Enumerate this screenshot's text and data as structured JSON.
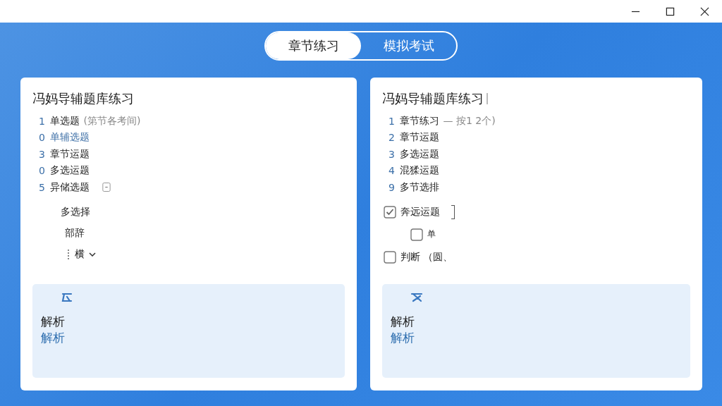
{
  "tabs": [
    {
      "label": "章节练习",
      "selected": true
    },
    {
      "label": "模拟考试",
      "selected": false
    }
  ],
  "cards": [
    {
      "title": "冯妈导辅题库练习",
      "title_cursor": false,
      "items": [
        {
          "num": "1",
          "label": "单选题",
          "note": "(第节各考间)",
          "highlighted": false,
          "has_toggle": false
        },
        {
          "num": "0",
          "label": "单辅选题",
          "highlighted": true,
          "has_toggle": false
        },
        {
          "num": "3",
          "label": "章节运题",
          "highlighted": false,
          "has_toggle": false
        },
        {
          "num": "0",
          "label": "多选运题",
          "highlighted": false,
          "has_toggle": false
        },
        {
          "num": "5",
          "label": "异储选题",
          "highlighted": false,
          "has_toggle": true
        }
      ],
      "options": [
        {
          "kind": "text",
          "label": "多选择"
        },
        {
          "kind": "text",
          "label": "部辞"
        },
        {
          "kind": "dropdown",
          "label": "横"
        }
      ],
      "analysis": {
        "label": "解析",
        "link": "解析"
      }
    },
    {
      "title": "冯妈导辅题库练习",
      "title_cursor": true,
      "items": [
        {
          "num": "1",
          "label": "章节练习",
          "note": "— 按1 2个)",
          "highlighted": false,
          "has_toggle": false
        },
        {
          "num": "2",
          "label": "章节运题",
          "highlighted": false,
          "has_toggle": false
        },
        {
          "num": "3",
          "label": "多选运题",
          "highlighted": false,
          "has_toggle": false
        },
        {
          "num": "4",
          "label": "混猱运题",
          "highlighted": false,
          "has_toggle": false
        },
        {
          "num": "9",
          "label": "多节选排",
          "highlighted": false,
          "has_toggle": false
        }
      ],
      "options": [
        {
          "kind": "checkbox",
          "label": "奔远运题",
          "checked": true,
          "indent": false,
          "bracket": true
        },
        {
          "kind": "checkbox",
          "label": "单",
          "checked": false,
          "indent": true,
          "bracket": false
        },
        {
          "kind": "checkbox",
          "label": "判断 （圆、",
          "checked": false,
          "indent": false,
          "bracket": false
        }
      ],
      "analysis": {
        "label": "解析",
        "link": "解析"
      }
    }
  ]
}
